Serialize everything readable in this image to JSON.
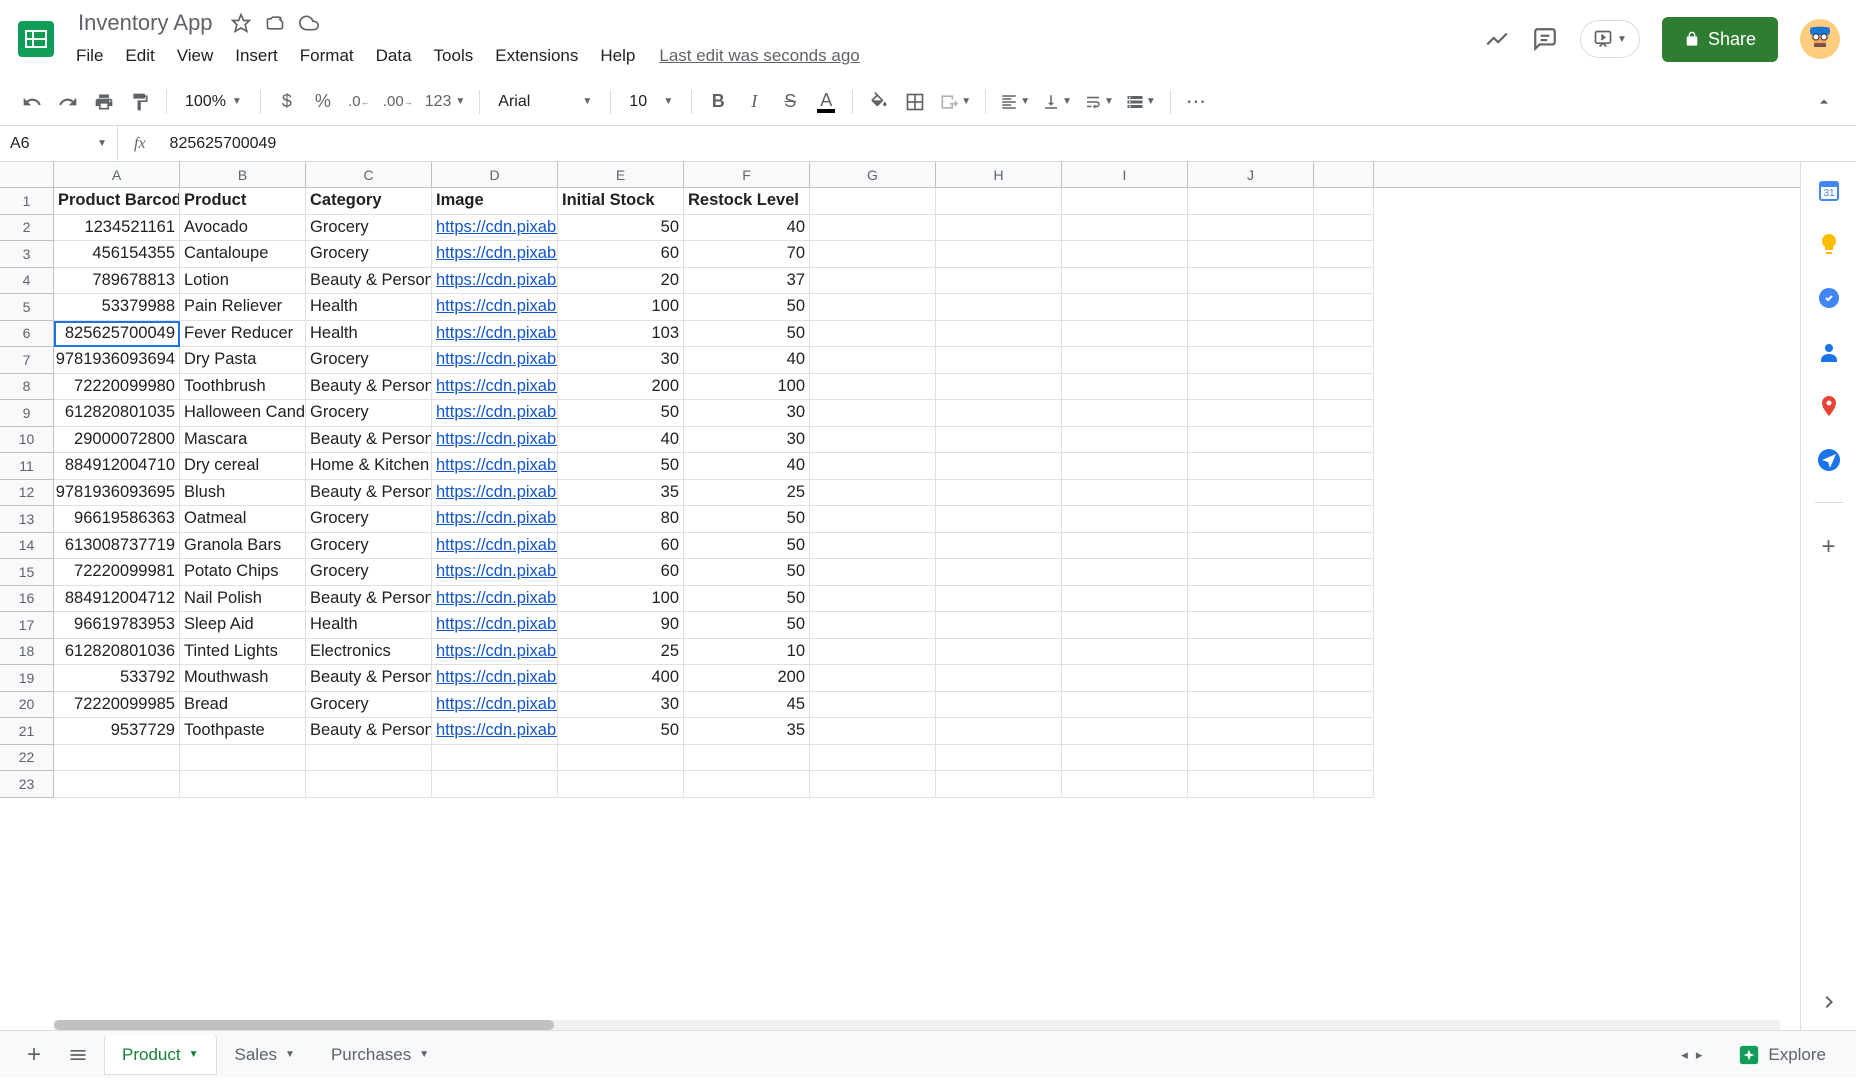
{
  "doc": {
    "title": "Inventory App",
    "last_edit": "Last edit was seconds ago"
  },
  "menu": [
    "File",
    "Edit",
    "View",
    "Insert",
    "Format",
    "Data",
    "Tools",
    "Extensions",
    "Help"
  ],
  "toolbar": {
    "zoom": "100%",
    "fmt123": "123",
    "font": "Arial",
    "size": "10"
  },
  "share": "Share",
  "cell_ref": "A6",
  "formula": "825625700049",
  "columns": [
    "A",
    "B",
    "C",
    "D",
    "E",
    "F",
    "G",
    "H",
    "I",
    "J"
  ],
  "headers": [
    "Product Barcode",
    "Product",
    "Category",
    "Image",
    "Initial Stock",
    "Restock Level"
  ],
  "rows": [
    {
      "barcode": "1234521161",
      "product": "Avocado",
      "category": "Grocery",
      "image": "https://cdn.pixaba",
      "stock": "50",
      "restock": "40"
    },
    {
      "barcode": "456154355",
      "product": "Cantaloupe",
      "category": "Grocery",
      "image": "https://cdn.pixaba",
      "stock": "60",
      "restock": "70"
    },
    {
      "barcode": "789678813",
      "product": "Lotion",
      "category": "Beauty & Personal",
      "image": "https://cdn.pixaba",
      "stock": "20",
      "restock": "37"
    },
    {
      "barcode": "53379988",
      "product": "Pain Reliever",
      "category": "Health",
      "image": "https://cdn.pixaba",
      "stock": "100",
      "restock": "50"
    },
    {
      "barcode": "825625700049",
      "product": "Fever Reducer",
      "category": "Health",
      "image": "https://cdn.pixaba",
      "stock": "103",
      "restock": "50"
    },
    {
      "barcode": "9781936093694",
      "product": "Dry Pasta",
      "category": "Grocery",
      "image": "https://cdn.pixaba",
      "stock": "30",
      "restock": "40"
    },
    {
      "barcode": "72220099980",
      "product": "Toothbrush",
      "category": "Beauty & Personal",
      "image": "https://cdn.pixaba",
      "stock": "200",
      "restock": "100"
    },
    {
      "barcode": "612820801035",
      "product": "Halloween Cand",
      "category": "Grocery",
      "image": "https://cdn.pixaba",
      "stock": "50",
      "restock": "30"
    },
    {
      "barcode": "29000072800",
      "product": "Mascara",
      "category": "Beauty & Personal",
      "image": "https://cdn.pixaba",
      "stock": "40",
      "restock": "30"
    },
    {
      "barcode": "884912004710",
      "product": "Dry cereal",
      "category": "Home & Kitchen",
      "image": "https://cdn.pixaba",
      "stock": "50",
      "restock": "40"
    },
    {
      "barcode": "9781936093695",
      "product": "Blush",
      "category": "Beauty & Personal",
      "image": "https://cdn.pixaba",
      "stock": "35",
      "restock": "25"
    },
    {
      "barcode": "96619586363",
      "product": "Oatmeal",
      "category": "Grocery",
      "image": "https://cdn.pixaba",
      "stock": "80",
      "restock": "50"
    },
    {
      "barcode": "613008737719",
      "product": "Granola Bars",
      "category": "Grocery",
      "image": "https://cdn.pixaba",
      "stock": "60",
      "restock": "50"
    },
    {
      "barcode": "72220099981",
      "product": "Potato Chips",
      "category": "Grocery",
      "image": "https://cdn.pixaba",
      "stock": "60",
      "restock": "50"
    },
    {
      "barcode": "884912004712",
      "product": "Nail Polish",
      "category": "Beauty & Personal",
      "image": "https://cdn.pixaba",
      "stock": "100",
      "restock": "50"
    },
    {
      "barcode": "96619783953",
      "product": "Sleep Aid",
      "category": "Health",
      "image": "https://cdn.pixaba",
      "stock": "90",
      "restock": "50"
    },
    {
      "barcode": "612820801036",
      "product": "Tinted Lights",
      "category": "Electronics",
      "image": "https://cdn.pixaba",
      "stock": "25",
      "restock": "10"
    },
    {
      "barcode": "533792",
      "product": "Mouthwash",
      "category": "Beauty & Personal",
      "image": "https://cdn.pixaba",
      "stock": "400",
      "restock": "200"
    },
    {
      "barcode": "72220099985",
      "product": "Bread",
      "category": "Grocery",
      "image": "https://cdn.pixaba",
      "stock": "30",
      "restock": "45"
    },
    {
      "barcode": "9537729",
      "product": "Toothpaste",
      "category": "Beauty & Personal",
      "image": "https://cdn.pixaba",
      "stock": "50",
      "restock": "35"
    }
  ],
  "tabs": [
    {
      "name": "Product",
      "active": true
    },
    {
      "name": "Sales",
      "active": false
    },
    {
      "name": "Purchases",
      "active": false
    }
  ],
  "explore": "Explore",
  "selected_row": 6
}
